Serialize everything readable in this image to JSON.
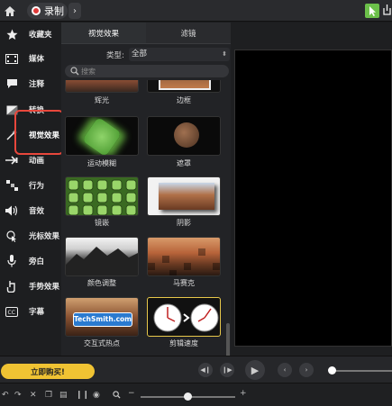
{
  "topbar": {
    "record_label": "录制",
    "home_icon": "home-icon",
    "chevron": "›"
  },
  "sidebar": {
    "items": [
      {
        "label": "收藏夹",
        "icon": "star-icon"
      },
      {
        "label": "媒体",
        "icon": "film-icon"
      },
      {
        "label": "注释",
        "icon": "annotation-icon"
      },
      {
        "label": "转换",
        "icon": "transition-icon"
      },
      {
        "label": "视觉效果",
        "icon": "magic-wand-icon"
      },
      {
        "label": "动画",
        "icon": "animation-icon"
      },
      {
        "label": "行为",
        "icon": "behavior-icon"
      },
      {
        "label": "音效",
        "icon": "speaker-icon"
      },
      {
        "label": "光标效果",
        "icon": "cursor-effect-icon"
      },
      {
        "label": "旁白",
        "icon": "microphone-icon"
      },
      {
        "label": "手势效果",
        "icon": "gesture-icon"
      },
      {
        "label": "字幕",
        "icon": "caption-icon"
      }
    ]
  },
  "panel": {
    "tabs": [
      "视觉效果",
      "滤镜"
    ],
    "filter_label": "类型:",
    "filter_value": "全部",
    "search_placeholder": "搜索",
    "effects": [
      {
        "label": "辉光"
      },
      {
        "label": "边框"
      },
      {
        "label": "运动模糊"
      },
      {
        "label": "遮罩"
      },
      {
        "label": "镜嵌"
      },
      {
        "label": "阴影"
      },
      {
        "label": "颜色调整"
      },
      {
        "label": "马赛克"
      },
      {
        "label": "交互式热点",
        "overlay": "TechSmith.com"
      },
      {
        "label": "剪辑速度"
      }
    ]
  },
  "transport": {
    "buy_label": "立即购买!"
  },
  "toolbar": {
    "zoom_minus": "−",
    "zoom_plus": "+"
  }
}
